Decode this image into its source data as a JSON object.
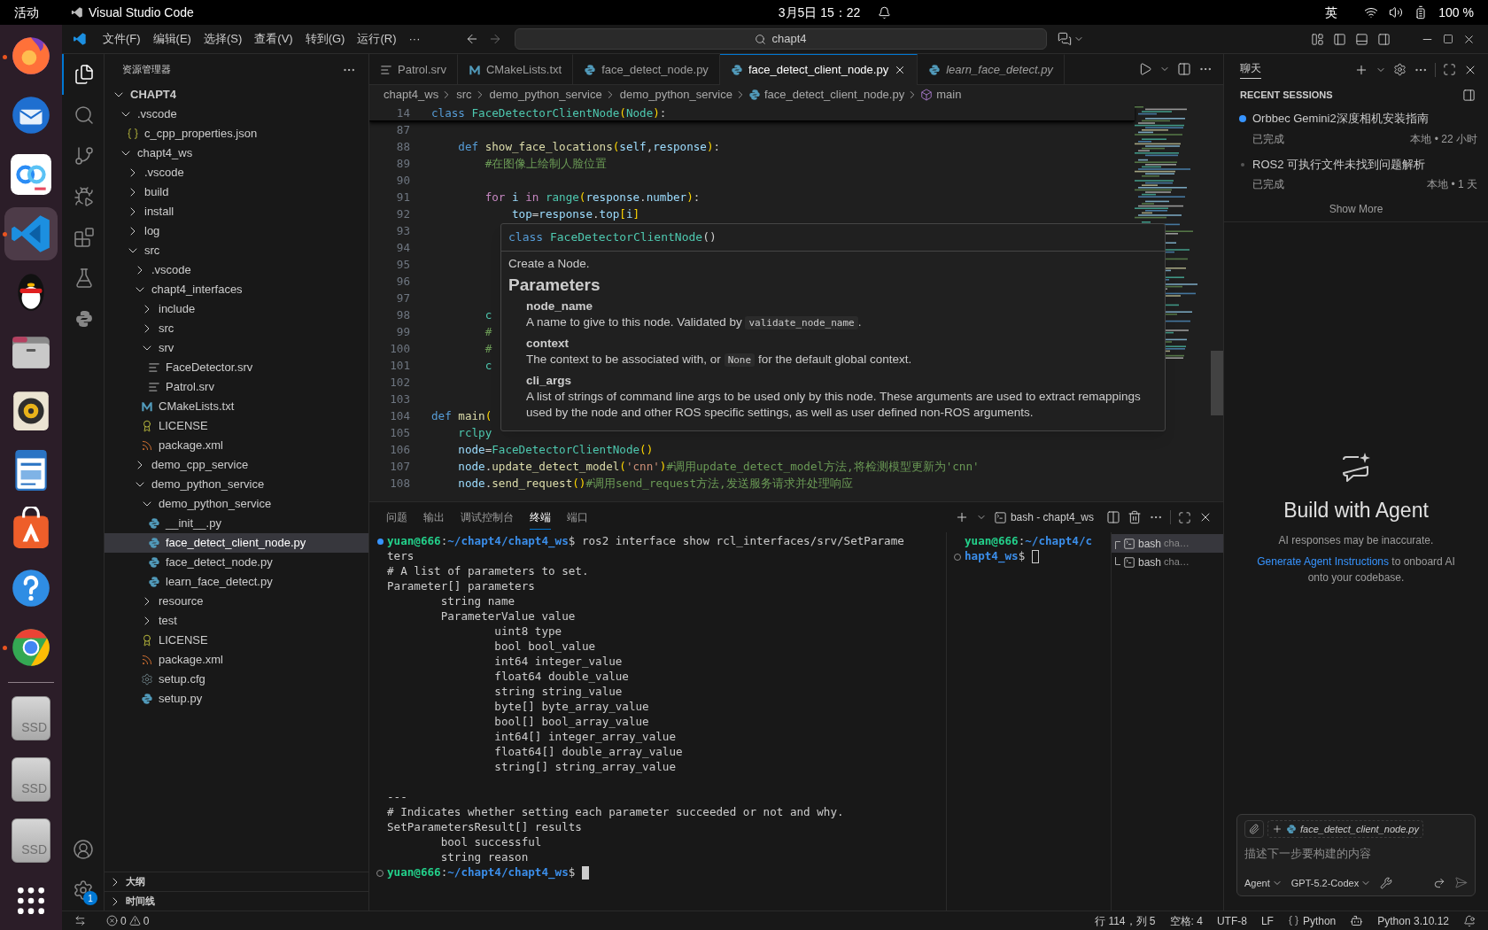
{
  "desktop_bar": {
    "activities": "活动",
    "app": "Visual Studio Code",
    "clock": "3月5日 15：22",
    "input_method": "英",
    "battery": "100 %"
  },
  "dock": [
    {
      "kind": "firefox",
      "running": true,
      "selected": false
    },
    {
      "kind": "thunderbird",
      "running": false,
      "selected": false
    },
    {
      "kind": "baidu",
      "running": false,
      "selected": false
    },
    {
      "kind": "vscode",
      "running": true,
      "selected": true
    },
    {
      "kind": "qq",
      "running": false,
      "selected": false
    },
    {
      "kind": "files",
      "running": false,
      "selected": false
    },
    {
      "kind": "rhythmbox",
      "running": false,
      "selected": false
    },
    {
      "kind": "writer",
      "running": false,
      "selected": false
    },
    {
      "kind": "appstore",
      "running": false,
      "selected": false
    },
    {
      "kind": "help",
      "running": false,
      "selected": false
    },
    {
      "kind": "chrome",
      "running": true,
      "selected": false
    },
    {
      "kind": "separator"
    },
    {
      "kind": "drive",
      "label": "SSD"
    },
    {
      "kind": "drive",
      "label": "SSD"
    },
    {
      "kind": "drive",
      "label": "SSD"
    },
    {
      "kind": "apps"
    }
  ],
  "titlebar": {
    "menu": [
      "文件(F)",
      "编辑(E)",
      "选择(S)",
      "查看(V)",
      "转到(G)",
      "运行(R)",
      "···"
    ],
    "search": "chapt4"
  },
  "activity_bar": {
    "items": [
      {
        "kind": "explorer",
        "selected": true
      },
      {
        "kind": "search",
        "selected": false
      },
      {
        "kind": "scm",
        "selected": false
      },
      {
        "kind": "debug",
        "selected": false
      },
      {
        "kind": "extensions",
        "selected": false
      },
      {
        "kind": "testing",
        "selected": false
      },
      {
        "kind": "python",
        "selected": false
      }
    ],
    "settings_badge": "1"
  },
  "explorer": {
    "title": "资源管理器",
    "root": {
      "name": "CHAPT4",
      "kind": "folder",
      "expanded": true,
      "selected": false,
      "children": [
        {
          "name": ".vscode",
          "kind": "folder",
          "expanded": true,
          "selected": false,
          "children": [
            {
              "name": "c_cpp_properties.json",
              "kind": "json",
              "selected": false
            }
          ]
        },
        {
          "name": "chapt4_ws",
          "kind": "folder",
          "expanded": true,
          "selected": false,
          "children": [
            {
              "name": ".vscode",
              "kind": "folder",
              "expanded": false,
              "selected": false
            },
            {
              "name": "build",
              "kind": "folder",
              "expanded": false,
              "selected": false
            },
            {
              "name": "install",
              "kind": "folder",
              "expanded": false,
              "selected": false
            },
            {
              "name": "log",
              "kind": "folder",
              "expanded": false,
              "selected": false
            },
            {
              "name": "src",
              "kind": "folder",
              "expanded": true,
              "selected": false,
              "children": [
                {
                  "name": ".vscode",
                  "kind": "folder",
                  "expanded": false,
                  "selected": false
                },
                {
                  "name": "chapt4_interfaces",
                  "kind": "folder",
                  "expanded": true,
                  "selected": false,
                  "children": [
                    {
                      "name": "include",
                      "kind": "folder",
                      "expanded": false,
                      "selected": false
                    },
                    {
                      "name": "src",
                      "kind": "folder",
                      "expanded": false,
                      "selected": false
                    },
                    {
                      "name": "srv",
                      "kind": "folder",
                      "expanded": true,
                      "selected": false,
                      "children": [
                        {
                          "name": "FaceDetector.srv",
                          "kind": "srv",
                          "selected": false
                        },
                        {
                          "name": "Patrol.srv",
                          "kind": "srv",
                          "selected": false
                        }
                      ]
                    },
                    {
                      "name": "CMakeLists.txt",
                      "kind": "cmake",
                      "selected": false
                    },
                    {
                      "name": "LICENSE",
                      "kind": "license",
                      "selected": false
                    },
                    {
                      "name": "package.xml",
                      "kind": "xml",
                      "selected": false
                    }
                  ]
                },
                {
                  "name": "demo_cpp_service",
                  "kind": "folder",
                  "expanded": false,
                  "selected": false
                },
                {
                  "name": "demo_python_service",
                  "kind": "folder",
                  "expanded": true,
                  "selected": false,
                  "children": [
                    {
                      "name": "demo_python_service",
                      "kind": "folder",
                      "expanded": true,
                      "selected": false,
                      "children": [
                        {
                          "name": "__init__.py",
                          "kind": "python",
                          "selected": false
                        },
                        {
                          "name": "face_detect_client_node.py",
                          "kind": "python",
                          "selected": true
                        },
                        {
                          "name": "face_detect_node.py",
                          "kind": "python",
                          "selected": false
                        },
                        {
                          "name": "learn_face_detect.py",
                          "kind": "python",
                          "selected": false
                        }
                      ]
                    },
                    {
                      "name": "resource",
                      "kind": "folder",
                      "expanded": false,
                      "selected": false
                    },
                    {
                      "name": "test",
                      "kind": "folder",
                      "expanded": false,
                      "selected": false
                    },
                    {
                      "name": "LICENSE",
                      "kind": "license",
                      "selected": false
                    },
                    {
                      "name": "package.xml",
                      "kind": "xml",
                      "selected": false
                    },
                    {
                      "name": "setup.cfg",
                      "kind": "cfg",
                      "selected": false
                    },
                    {
                      "name": "setup.py",
                      "kind": "python",
                      "selected": false
                    }
                  ]
                }
              ]
            }
          ]
        }
      ]
    },
    "sections": [
      {
        "label": "大纲",
        "expanded": false
      },
      {
        "label": "时间线",
        "expanded": false
      }
    ]
  },
  "tabs": [
    {
      "label": "Patrol.srv",
      "kind": "srv",
      "selected": false,
      "preview": false
    },
    {
      "label": "CMakeLists.txt",
      "kind": "cmake",
      "selected": false,
      "preview": false
    },
    {
      "label": "face_detect_node.py",
      "kind": "python",
      "selected": false,
      "preview": false
    },
    {
      "label": "face_detect_client_node.py",
      "kind": "python",
      "selected": true,
      "preview": false
    },
    {
      "label": "learn_face_detect.py",
      "kind": "python",
      "selected": false,
      "preview": true
    }
  ],
  "breadcrumb": [
    {
      "label": "chapt4_ws",
      "kind": "folder"
    },
    {
      "label": "src",
      "kind": "folder"
    },
    {
      "label": "demo_python_service",
      "kind": "folder"
    },
    {
      "label": "demo_python_service",
      "kind": "folder"
    },
    {
      "label": "face_detect_client_node.py",
      "kind": "python"
    },
    {
      "label": "main",
      "kind": "method"
    }
  ],
  "editor": {
    "sticky": {
      "number": "14",
      "tokens": [
        {
          "kind": "keyword",
          "text": "class "
        },
        {
          "kind": "class",
          "text": "FaceDetectorClientNode"
        },
        {
          "kind": "bracket",
          "text": "("
        },
        {
          "kind": "class",
          "text": "Node"
        },
        {
          "kind": "bracket",
          "text": ")"
        },
        {
          "kind": "plain",
          "text": ":"
        }
      ]
    },
    "lines": [
      {
        "number": "87"
      },
      {
        "number": "88",
        "tokens": [
          {
            "kind": "keyword",
            "text": "    def "
          },
          {
            "kind": "function",
            "text": "show_face_locations"
          },
          {
            "kind": "bracket",
            "text": "("
          },
          {
            "kind": "variable",
            "text": "self"
          },
          {
            "kind": "plain",
            "text": ","
          },
          {
            "kind": "variable",
            "text": "response"
          },
          {
            "kind": "bracket",
            "text": ")"
          },
          {
            "kind": "plain",
            "text": ":"
          }
        ]
      },
      {
        "number": "89",
        "tokens": [
          {
            "kind": "comment",
            "text": "        #在图像上绘制人脸位置"
          }
        ]
      },
      {
        "number": "90"
      },
      {
        "number": "91",
        "tokens": [
          {
            "kind": "control",
            "text": "        for "
          },
          {
            "kind": "variable",
            "text": "i "
          },
          {
            "kind": "control",
            "text": "in "
          },
          {
            "kind": "class",
            "text": "range"
          },
          {
            "kind": "bracket",
            "text": "("
          },
          {
            "kind": "variable",
            "text": "response"
          },
          {
            "kind": "plain",
            "text": "."
          },
          {
            "kind": "variable",
            "text": "number"
          },
          {
            "kind": "bracket",
            "text": ")"
          },
          {
            "kind": "plain",
            "text": ":"
          }
        ]
      },
      {
        "number": "92",
        "tokens": [
          {
            "kind": "variable",
            "text": "            top"
          },
          {
            "kind": "plain",
            "text": "="
          },
          {
            "kind": "variable",
            "text": "response"
          },
          {
            "kind": "plain",
            "text": "."
          },
          {
            "kind": "variable",
            "text": "top"
          },
          {
            "kind": "bracket",
            "text": "["
          },
          {
            "kind": "variable",
            "text": "i"
          },
          {
            "kind": "bracket",
            "text": "]"
          }
        ]
      },
      {
        "number": "93"
      },
      {
        "number": "94"
      },
      {
        "number": "95"
      },
      {
        "number": "96"
      },
      {
        "number": "97"
      },
      {
        "number": "98",
        "tokens": [
          {
            "kind": "class",
            "text": "        c"
          }
        ]
      },
      {
        "number": "99",
        "tokens": [
          {
            "kind": "comment",
            "text": "        #"
          }
        ]
      },
      {
        "number": "100",
        "tokens": [
          {
            "kind": "comment",
            "text": "        #"
          }
        ]
      },
      {
        "number": "101",
        "tokens": [
          {
            "kind": "class",
            "text": "        c"
          }
        ]
      },
      {
        "number": "102"
      },
      {
        "number": "103"
      },
      {
        "number": "104",
        "tokens": [
          {
            "kind": "keyword",
            "text": "def "
          },
          {
            "kind": "function",
            "text": "main"
          },
          {
            "kind": "bracket",
            "text": "("
          }
        ]
      },
      {
        "number": "105",
        "tokens": [
          {
            "kind": "class",
            "text": "    rclpy"
          }
        ]
      },
      {
        "number": "106",
        "tokens": [
          {
            "kind": "variable",
            "text": "    node"
          },
          {
            "kind": "plain",
            "text": "="
          },
          {
            "kind": "class",
            "text": "FaceDetectorClientNode"
          },
          {
            "kind": "bracket",
            "text": "()"
          }
        ]
      },
      {
        "number": "107",
        "tokens": [
          {
            "kind": "variable",
            "text": "    node"
          },
          {
            "kind": "plain",
            "text": "."
          },
          {
            "kind": "function",
            "text": "update_detect_model"
          },
          {
            "kind": "bracket",
            "text": "("
          },
          {
            "kind": "string",
            "text": "'cnn'"
          },
          {
            "kind": "bracket",
            "text": ")"
          },
          {
            "kind": "comment",
            "text": "#调用update_detect_model方法,将检测模型更新为'cnn'"
          }
        ]
      },
      {
        "number": "108",
        "tokens": [
          {
            "kind": "variable",
            "text": "    node"
          },
          {
            "kind": "plain",
            "text": "."
          },
          {
            "kind": "function",
            "text": "send_request"
          },
          {
            "kind": "bracket",
            "text": "()"
          },
          {
            "kind": "comment",
            "text": "#调用send_request方法,发送服务请求并处理响应"
          }
        ]
      }
    ]
  },
  "hover": {
    "signature": [
      {
        "kind": "keyword",
        "text": "class "
      },
      {
        "kind": "class",
        "text": "FaceDetectorClientNode"
      },
      {
        "kind": "plain",
        "text": "()"
      }
    ],
    "summary": "Create a Node.",
    "heading": "Parameters",
    "params": [
      {
        "name": "node_name",
        "desc": [
          {
            "kind": "text",
            "text": "A name to give to this node. Validated by "
          },
          {
            "kind": "code",
            "text": "validate_node_name"
          },
          {
            "kind": "text",
            "text": "."
          }
        ]
      },
      {
        "name": "context",
        "desc": [
          {
            "kind": "text",
            "text": "The context to be associated with, or "
          },
          {
            "kind": "code",
            "text": "None"
          },
          {
            "kind": "text",
            "text": " for the default global context."
          }
        ]
      },
      {
        "name": "cli_args",
        "desc": [
          {
            "kind": "text",
            "text": "A list of strings of command line args to be used only by this node. These arguments are used to extract remappings used by the node and other ROS specific settings, as well as user defined non-ROS arguments."
          }
        ]
      }
    ]
  },
  "panel": {
    "tabs": [
      {
        "label": "问题",
        "selected": false
      },
      {
        "label": "输出",
        "selected": false
      },
      {
        "label": "调试控制台",
        "selected": false
      },
      {
        "label": "终端",
        "selected": true
      },
      {
        "label": "端口",
        "selected": false
      }
    ],
    "terminal_title": "bash - chapt4_ws",
    "terminal": [
      {
        "completed": true,
        "segments": [
          {
            "kind": "user",
            "text": "yuan@666"
          },
          {
            "kind": "plain",
            "text": ":"
          },
          {
            "kind": "path",
            "text": "~/chapt4/chapt4_ws"
          },
          {
            "kind": "plain",
            "text": "$ ros2 interface show rcl_interfaces/srv/SetParame"
          }
        ]
      },
      {
        "segments": [
          {
            "kind": "plain",
            "text": "ters"
          }
        ]
      },
      {
        "segments": [
          {
            "kind": "plain",
            "text": "# A list of parameters to set."
          }
        ]
      },
      {
        "segments": [
          {
            "kind": "plain",
            "text": "Parameter[] parameters"
          }
        ]
      },
      {
        "segments": [
          {
            "kind": "plain",
            "text": "        string name"
          }
        ]
      },
      {
        "segments": [
          {
            "kind": "plain",
            "text": "        ParameterValue value"
          }
        ]
      },
      {
        "segments": [
          {
            "kind": "plain",
            "text": "                uint8 type"
          }
        ]
      },
      {
        "segments": [
          {
            "kind": "plain",
            "text": "                bool bool_value"
          }
        ]
      },
      {
        "segments": [
          {
            "kind": "plain",
            "text": "                int64 integer_value"
          }
        ]
      },
      {
        "segments": [
          {
            "kind": "plain",
            "text": "                float64 double_value"
          }
        ]
      },
      {
        "segments": [
          {
            "kind": "plain",
            "text": "                string string_value"
          }
        ]
      },
      {
        "segments": [
          {
            "kind": "plain",
            "text": "                byte[] byte_array_value"
          }
        ]
      },
      {
        "segments": [
          {
            "kind": "plain",
            "text": "                bool[] bool_array_value"
          }
        ]
      },
      {
        "segments": [
          {
            "kind": "plain",
            "text": "                int64[] integer_array_value"
          }
        ]
      },
      {
        "segments": [
          {
            "kind": "plain",
            "text": "                float64[] double_array_value"
          }
        ]
      },
      {
        "segments": [
          {
            "kind": "plain",
            "text": "                string[] string_array_value"
          }
        ]
      },
      {
        "kind": "blank"
      },
      {
        "segments": [
          {
            "kind": "plain",
            "text": "---"
          }
        ]
      },
      {
        "segments": [
          {
            "kind": "plain",
            "text": "# Indicates whether setting each parameter succeeded or not and why."
          }
        ]
      },
      {
        "segments": [
          {
            "kind": "plain",
            "text": "SetParametersResult[] results"
          }
        ]
      },
      {
        "segments": [
          {
            "kind": "plain",
            "text": "        bool successful"
          }
        ]
      },
      {
        "segments": [
          {
            "kind": "plain",
            "text": "        string reason"
          }
        ]
      },
      {
        "completed": false,
        "cursor_focused": true,
        "segments": [
          {
            "kind": "user",
            "text": "yuan@666"
          },
          {
            "kind": "plain",
            "text": ":"
          },
          {
            "kind": "path",
            "text": "~/chapt4/chapt4_ws"
          },
          {
            "kind": "plain",
            "text": "$ "
          }
        ]
      }
    ],
    "side_terminal": [
      {
        "segments": [
          {
            "kind": "user",
            "text": "yuan@666"
          },
          {
            "kind": "plain",
            "text": ":"
          },
          {
            "kind": "path",
            "text": "~/chapt4/c"
          }
        ]
      },
      {
        "completed": false,
        "cursor_focused": false,
        "segments": [
          {
            "kind": "path",
            "text": "hapt4_ws"
          },
          {
            "kind": "plain",
            "text": "$ "
          }
        ]
      }
    ],
    "terminals": [
      {
        "label": "bash",
        "detail": "cha…",
        "selected": true
      },
      {
        "label": "bash",
        "detail": "cha…",
        "selected": false
      }
    ]
  },
  "chat": {
    "tab": "聊天",
    "recent_title": "RECENT SESSIONS",
    "sessions": [
      {
        "title": "Orbbec Gemini2深度相机安装指南",
        "status": "已完成",
        "meta": "本地 • 22 小时",
        "unread": true
      },
      {
        "title": "ROS2 可执行文件未找到问题解析",
        "status": "已完成",
        "meta": "本地 • 1 天",
        "unread": false
      }
    ],
    "show_more": "Show More",
    "empty": {
      "title": "Build with Agent",
      "note": "AI responses may be inaccurate.",
      "link": "Generate Agent Instructions",
      "link_after": " to onboard AI onto your codebase."
    },
    "input": {
      "attachment": "face_detect_client_node.py",
      "placeholder": "描述下一步要构建的内容",
      "mode": "Agent",
      "model": "GPT-5.2-Codex"
    }
  },
  "status_bar": {
    "errors": "0",
    "warnings": "0",
    "position": "行 114，列 5",
    "spaces": "空格: 4",
    "encoding": "UTF-8",
    "eol": "LF",
    "language": "Python",
    "interpreter": "Python 3.10.12"
  }
}
